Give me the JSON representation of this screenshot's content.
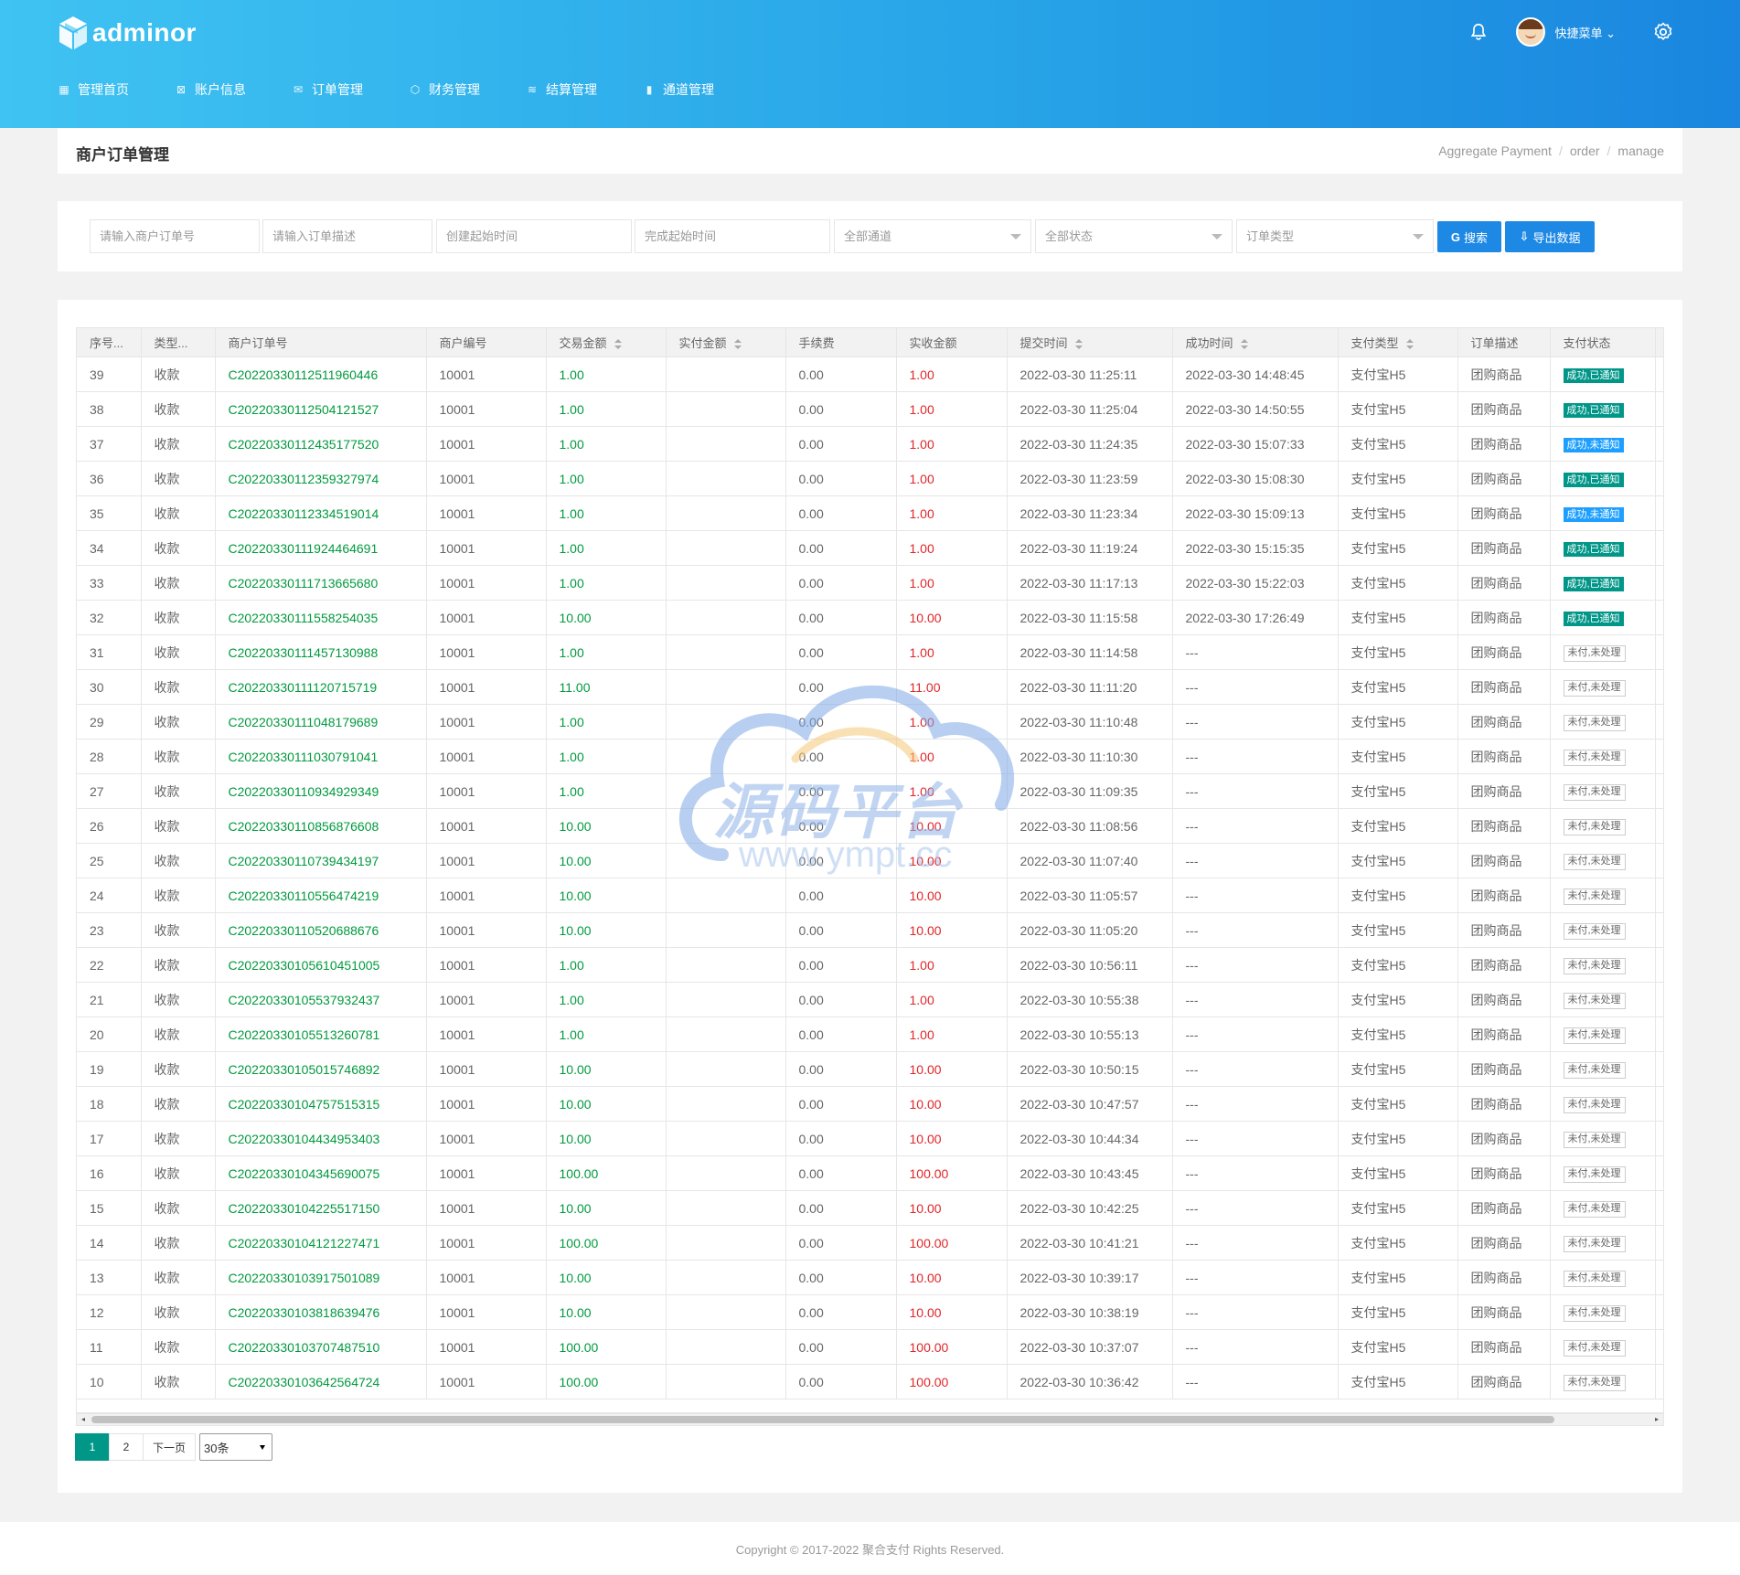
{
  "brand": {
    "name": "adminor"
  },
  "header": {
    "user_menu_label": "快捷菜单"
  },
  "nav": [
    {
      "icon": "grid-icon",
      "glyph": "▦",
      "label": "管理首页"
    },
    {
      "icon": "account-icon",
      "glyph": "⊠",
      "label": "账户信息"
    },
    {
      "icon": "mail-icon",
      "glyph": "✉",
      "label": "订单管理"
    },
    {
      "icon": "cube-icon",
      "glyph": "⬡",
      "label": "财务管理"
    },
    {
      "icon": "layers-icon",
      "glyph": "≋",
      "label": "结算管理"
    },
    {
      "icon": "document-icon",
      "glyph": "▮",
      "label": "通道管理"
    }
  ],
  "page": {
    "title": "商户订单管理"
  },
  "breadcrumb": [
    "Aggregate Payment",
    "order",
    "manage"
  ],
  "filters": {
    "merchant_order_placeholder": "请输入商户订单号",
    "order_desc_placeholder": "请输入订单描述",
    "create_start_placeholder": "创建起始时间",
    "complete_start_placeholder": "完成起始时间",
    "channel_select": "全部通道",
    "status_select": "全部状态",
    "order_type_select": "订单类型",
    "search_label": "搜索",
    "export_label": "导出数据"
  },
  "table": {
    "columns": [
      "序号...",
      "类型...",
      "商户订单号",
      "商户编号",
      "交易金额",
      "实付金额",
      "手续费",
      "实收金额",
      "提交时间",
      "成功时间",
      "支付类型",
      "订单描述",
      "支付状态"
    ],
    "rows": [
      {
        "id": "39",
        "type": "收款",
        "order_no": "C20220330112511960446",
        "merchant": "10001",
        "amount": "1.00",
        "paid": "",
        "fee": "0.00",
        "received": "1.00",
        "submit": "2022-03-30 11:25:11",
        "success": "2022-03-30 14:48:45",
        "pay_type": "支付宝H5",
        "desc": "团购商品",
        "status": "成功,已通知",
        "status_kind": "ok"
      },
      {
        "id": "38",
        "type": "收款",
        "order_no": "C20220330112504121527",
        "merchant": "10001",
        "amount": "1.00",
        "paid": "",
        "fee": "0.00",
        "received": "1.00",
        "submit": "2022-03-30 11:25:04",
        "success": "2022-03-30 14:50:55",
        "pay_type": "支付宝H5",
        "desc": "团购商品",
        "status": "成功,已通知",
        "status_kind": "ok"
      },
      {
        "id": "37",
        "type": "收款",
        "order_no": "C20220330112435177520",
        "merchant": "10001",
        "amount": "1.00",
        "paid": "",
        "fee": "0.00",
        "received": "1.00",
        "submit": "2022-03-30 11:24:35",
        "success": "2022-03-30 15:07:33",
        "pay_type": "支付宝H5",
        "desc": "团购商品",
        "status": "成功,未通知",
        "status_kind": "blue"
      },
      {
        "id": "36",
        "type": "收款",
        "order_no": "C20220330112359327974",
        "merchant": "10001",
        "amount": "1.00",
        "paid": "",
        "fee": "0.00",
        "received": "1.00",
        "submit": "2022-03-30 11:23:59",
        "success": "2022-03-30 15:08:30",
        "pay_type": "支付宝H5",
        "desc": "团购商品",
        "status": "成功,已通知",
        "status_kind": "ok"
      },
      {
        "id": "35",
        "type": "收款",
        "order_no": "C20220330112334519014",
        "merchant": "10001",
        "amount": "1.00",
        "paid": "",
        "fee": "0.00",
        "received": "1.00",
        "submit": "2022-03-30 11:23:34",
        "success": "2022-03-30 15:09:13",
        "pay_type": "支付宝H5",
        "desc": "团购商品",
        "status": "成功,未通知",
        "status_kind": "blue"
      },
      {
        "id": "34",
        "type": "收款",
        "order_no": "C20220330111924464691",
        "merchant": "10001",
        "amount": "1.00",
        "paid": "",
        "fee": "0.00",
        "received": "1.00",
        "submit": "2022-03-30 11:19:24",
        "success": "2022-03-30 15:15:35",
        "pay_type": "支付宝H5",
        "desc": "团购商品",
        "status": "成功,已通知",
        "status_kind": "ok"
      },
      {
        "id": "33",
        "type": "收款",
        "order_no": "C20220330111713665680",
        "merchant": "10001",
        "amount": "1.00",
        "paid": "",
        "fee": "0.00",
        "received": "1.00",
        "submit": "2022-03-30 11:17:13",
        "success": "2022-03-30 15:22:03",
        "pay_type": "支付宝H5",
        "desc": "团购商品",
        "status": "成功,已通知",
        "status_kind": "ok"
      },
      {
        "id": "32",
        "type": "收款",
        "order_no": "C20220330111558254035",
        "merchant": "10001",
        "amount": "10.00",
        "paid": "",
        "fee": "0.00",
        "received": "10.00",
        "submit": "2022-03-30 11:15:58",
        "success": "2022-03-30 17:26:49",
        "pay_type": "支付宝H5",
        "desc": "团购商品",
        "status": "成功,已通知",
        "status_kind": "ok"
      },
      {
        "id": "31",
        "type": "收款",
        "order_no": "C20220330111457130988",
        "merchant": "10001",
        "amount": "1.00",
        "paid": "",
        "fee": "0.00",
        "received": "1.00",
        "submit": "2022-03-30 11:14:58",
        "success": "---",
        "pay_type": "支付宝H5",
        "desc": "团购商品",
        "status": "未付,未处理",
        "status_kind": "gray"
      },
      {
        "id": "30",
        "type": "收款",
        "order_no": "C20220330111120715719",
        "merchant": "10001",
        "amount": "11.00",
        "paid": "",
        "fee": "0.00",
        "received": "11.00",
        "submit": "2022-03-30 11:11:20",
        "success": "---",
        "pay_type": "支付宝H5",
        "desc": "团购商品",
        "status": "未付,未处理",
        "status_kind": "gray"
      },
      {
        "id": "29",
        "type": "收款",
        "order_no": "C20220330111048179689",
        "merchant": "10001",
        "amount": "1.00",
        "paid": "",
        "fee": "0.00",
        "received": "1.00",
        "submit": "2022-03-30 11:10:48",
        "success": "---",
        "pay_type": "支付宝H5",
        "desc": "团购商品",
        "status": "未付,未处理",
        "status_kind": "gray"
      },
      {
        "id": "28",
        "type": "收款",
        "order_no": "C20220330111030791041",
        "merchant": "10001",
        "amount": "1.00",
        "paid": "",
        "fee": "0.00",
        "received": "1.00",
        "submit": "2022-03-30 11:10:30",
        "success": "---",
        "pay_type": "支付宝H5",
        "desc": "团购商品",
        "status": "未付,未处理",
        "status_kind": "gray"
      },
      {
        "id": "27",
        "type": "收款",
        "order_no": "C20220330110934929349",
        "merchant": "10001",
        "amount": "1.00",
        "paid": "",
        "fee": "0.00",
        "received": "1.00",
        "submit": "2022-03-30 11:09:35",
        "success": "---",
        "pay_type": "支付宝H5",
        "desc": "团购商品",
        "status": "未付,未处理",
        "status_kind": "gray"
      },
      {
        "id": "26",
        "type": "收款",
        "order_no": "C20220330110856876608",
        "merchant": "10001",
        "amount": "10.00",
        "paid": "",
        "fee": "0.00",
        "received": "10.00",
        "submit": "2022-03-30 11:08:56",
        "success": "---",
        "pay_type": "支付宝H5",
        "desc": "团购商品",
        "status": "未付,未处理",
        "status_kind": "gray"
      },
      {
        "id": "25",
        "type": "收款",
        "order_no": "C20220330110739434197",
        "merchant": "10001",
        "amount": "10.00",
        "paid": "",
        "fee": "0.00",
        "received": "10.00",
        "submit": "2022-03-30 11:07:40",
        "success": "---",
        "pay_type": "支付宝H5",
        "desc": "团购商品",
        "status": "未付,未处理",
        "status_kind": "gray"
      },
      {
        "id": "24",
        "type": "收款",
        "order_no": "C20220330110556474219",
        "merchant": "10001",
        "amount": "10.00",
        "paid": "",
        "fee": "0.00",
        "received": "10.00",
        "submit": "2022-03-30 11:05:57",
        "success": "---",
        "pay_type": "支付宝H5",
        "desc": "团购商品",
        "status": "未付,未处理",
        "status_kind": "gray"
      },
      {
        "id": "23",
        "type": "收款",
        "order_no": "C20220330110520688676",
        "merchant": "10001",
        "amount": "10.00",
        "paid": "",
        "fee": "0.00",
        "received": "10.00",
        "submit": "2022-03-30 11:05:20",
        "success": "---",
        "pay_type": "支付宝H5",
        "desc": "团购商品",
        "status": "未付,未处理",
        "status_kind": "gray"
      },
      {
        "id": "22",
        "type": "收款",
        "order_no": "C20220330105610451005",
        "merchant": "10001",
        "amount": "1.00",
        "paid": "",
        "fee": "0.00",
        "received": "1.00",
        "submit": "2022-03-30 10:56:11",
        "success": "---",
        "pay_type": "支付宝H5",
        "desc": "团购商品",
        "status": "未付,未处理",
        "status_kind": "gray"
      },
      {
        "id": "21",
        "type": "收款",
        "order_no": "C20220330105537932437",
        "merchant": "10001",
        "amount": "1.00",
        "paid": "",
        "fee": "0.00",
        "received": "1.00",
        "submit": "2022-03-30 10:55:38",
        "success": "---",
        "pay_type": "支付宝H5",
        "desc": "团购商品",
        "status": "未付,未处理",
        "status_kind": "gray"
      },
      {
        "id": "20",
        "type": "收款",
        "order_no": "C20220330105513260781",
        "merchant": "10001",
        "amount": "1.00",
        "paid": "",
        "fee": "0.00",
        "received": "1.00",
        "submit": "2022-03-30 10:55:13",
        "success": "---",
        "pay_type": "支付宝H5",
        "desc": "团购商品",
        "status": "未付,未处理",
        "status_kind": "gray"
      },
      {
        "id": "19",
        "type": "收款",
        "order_no": "C20220330105015746892",
        "merchant": "10001",
        "amount": "10.00",
        "paid": "",
        "fee": "0.00",
        "received": "10.00",
        "submit": "2022-03-30 10:50:15",
        "success": "---",
        "pay_type": "支付宝H5",
        "desc": "团购商品",
        "status": "未付,未处理",
        "status_kind": "gray"
      },
      {
        "id": "18",
        "type": "收款",
        "order_no": "C20220330104757515315",
        "merchant": "10001",
        "amount": "10.00",
        "paid": "",
        "fee": "0.00",
        "received": "10.00",
        "submit": "2022-03-30 10:47:57",
        "success": "---",
        "pay_type": "支付宝H5",
        "desc": "团购商品",
        "status": "未付,未处理",
        "status_kind": "gray"
      },
      {
        "id": "17",
        "type": "收款",
        "order_no": "C20220330104434953403",
        "merchant": "10001",
        "amount": "10.00",
        "paid": "",
        "fee": "0.00",
        "received": "10.00",
        "submit": "2022-03-30 10:44:34",
        "success": "---",
        "pay_type": "支付宝H5",
        "desc": "团购商品",
        "status": "未付,未处理",
        "status_kind": "gray"
      },
      {
        "id": "16",
        "type": "收款",
        "order_no": "C20220330104345690075",
        "merchant": "10001",
        "amount": "100.00",
        "paid": "",
        "fee": "0.00",
        "received": "100.00",
        "submit": "2022-03-30 10:43:45",
        "success": "---",
        "pay_type": "支付宝H5",
        "desc": "团购商品",
        "status": "未付,未处理",
        "status_kind": "gray"
      },
      {
        "id": "15",
        "type": "收款",
        "order_no": "C20220330104225517150",
        "merchant": "10001",
        "amount": "10.00",
        "paid": "",
        "fee": "0.00",
        "received": "10.00",
        "submit": "2022-03-30 10:42:25",
        "success": "---",
        "pay_type": "支付宝H5",
        "desc": "团购商品",
        "status": "未付,未处理",
        "status_kind": "gray"
      },
      {
        "id": "14",
        "type": "收款",
        "order_no": "C20220330104121227471",
        "merchant": "10001",
        "amount": "100.00",
        "paid": "",
        "fee": "0.00",
        "received": "100.00",
        "submit": "2022-03-30 10:41:21",
        "success": "---",
        "pay_type": "支付宝H5",
        "desc": "团购商品",
        "status": "未付,未处理",
        "status_kind": "gray"
      },
      {
        "id": "13",
        "type": "收款",
        "order_no": "C20220330103917501089",
        "merchant": "10001",
        "amount": "10.00",
        "paid": "",
        "fee": "0.00",
        "received": "10.00",
        "submit": "2022-03-30 10:39:17",
        "success": "---",
        "pay_type": "支付宝H5",
        "desc": "团购商品",
        "status": "未付,未处理",
        "status_kind": "gray"
      },
      {
        "id": "12",
        "type": "收款",
        "order_no": "C20220330103818639476",
        "merchant": "10001",
        "amount": "10.00",
        "paid": "",
        "fee": "0.00",
        "received": "10.00",
        "submit": "2022-03-30 10:38:19",
        "success": "---",
        "pay_type": "支付宝H5",
        "desc": "团购商品",
        "status": "未付,未处理",
        "status_kind": "gray"
      },
      {
        "id": "11",
        "type": "收款",
        "order_no": "C20220330103707487510",
        "merchant": "10001",
        "amount": "100.00",
        "paid": "",
        "fee": "0.00",
        "received": "100.00",
        "submit": "2022-03-30 10:37:07",
        "success": "---",
        "pay_type": "支付宝H5",
        "desc": "团购商品",
        "status": "未付,未处理",
        "status_kind": "gray"
      },
      {
        "id": "10",
        "type": "收款",
        "order_no": "C20220330103642564724",
        "merchant": "10001",
        "amount": "100.00",
        "paid": "",
        "fee": "0.00",
        "received": "100.00",
        "submit": "2022-03-30 10:36:42",
        "success": "---",
        "pay_type": "支付宝H5",
        "desc": "团购商品",
        "status": "未付,未处理",
        "status_kind": "gray"
      }
    ]
  },
  "pagination": {
    "pages": [
      "1",
      "2"
    ],
    "current": "1",
    "next_label": "下一页",
    "page_size": "30条"
  },
  "watermark": {
    "text": "源码平台",
    "url": "www.ympt.cc"
  },
  "footer": {
    "copyright": "Copyright © 2017-2022 聚合支付 Rights Reserved."
  },
  "colors": {
    "header_start": "#3fc3f2",
    "header_end": "#1a86df",
    "primary": "#1e88e5",
    "success": "#009688",
    "info": "#1e9fff",
    "amount": "#009a3e",
    "received": "#e0262a"
  }
}
